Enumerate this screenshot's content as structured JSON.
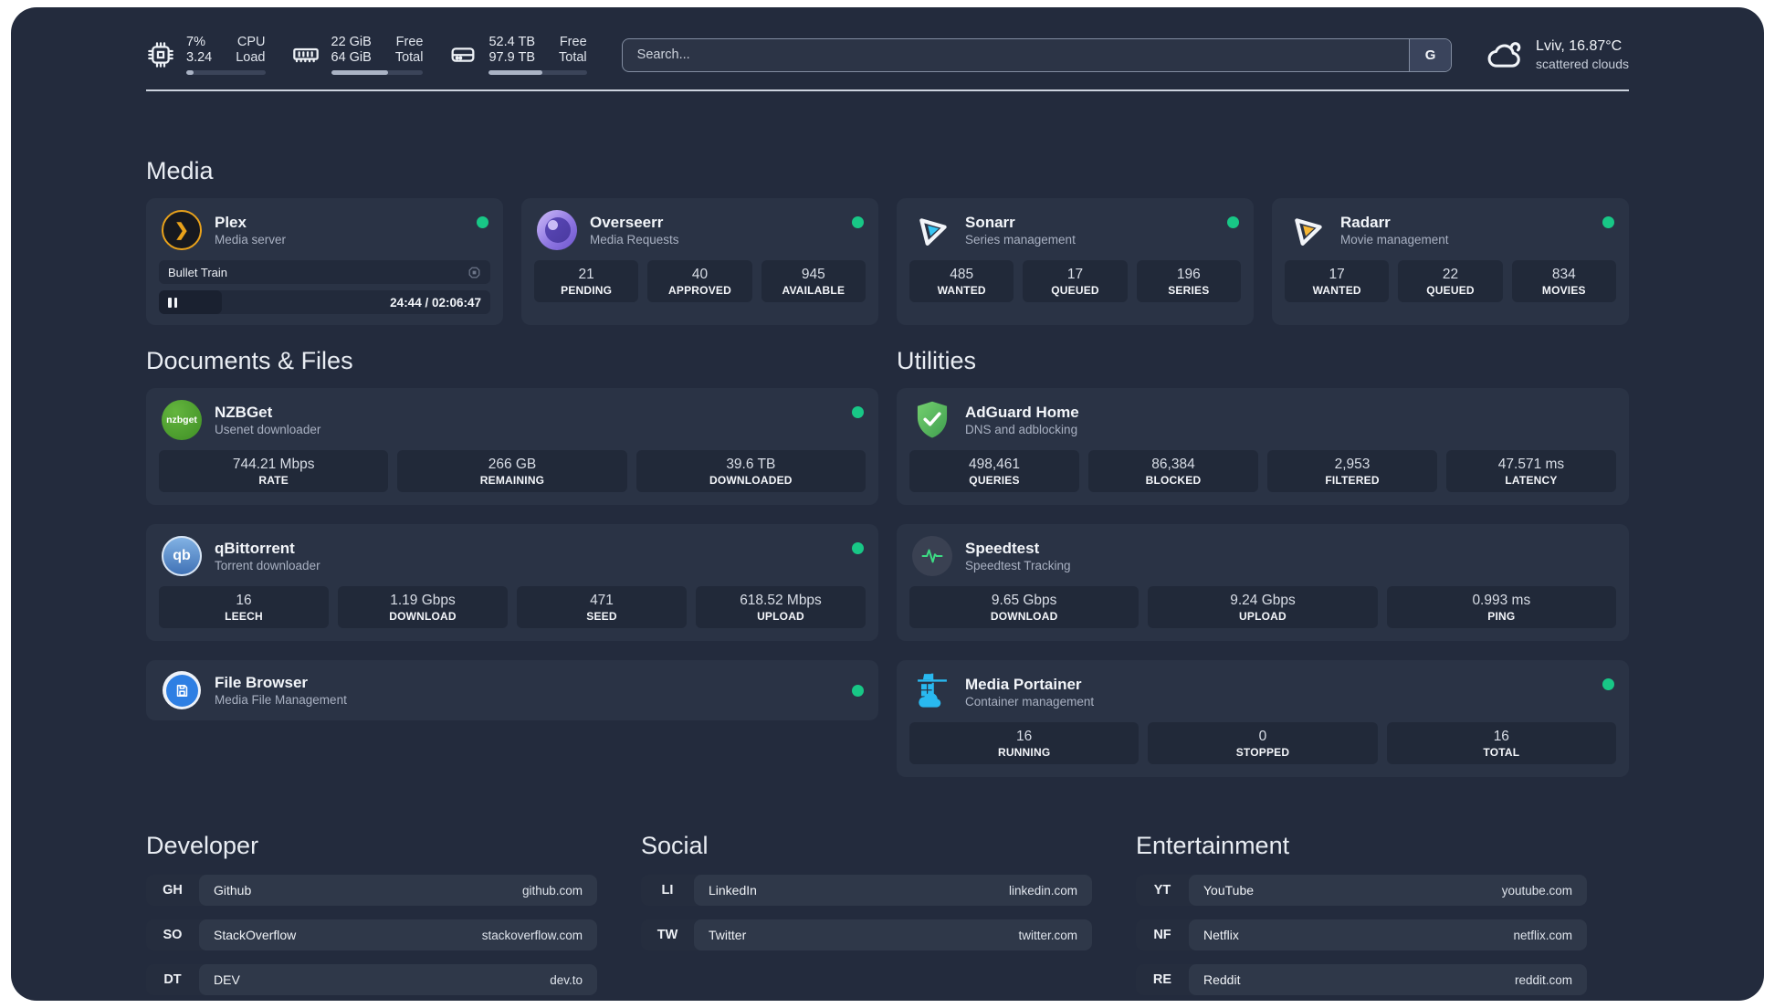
{
  "header": {
    "system": [
      {
        "icon": "cpu-icon",
        "value1": "7%",
        "label1": "CPU",
        "value2": "3.24",
        "label2": "Load",
        "progress": 9
      },
      {
        "icon": "ram-icon",
        "value1": "22 GiB",
        "label1": "Free",
        "value2": "64 GiB",
        "label2": "Total",
        "progress": 62
      },
      {
        "icon": "disk-icon",
        "value1": "52.4 TB",
        "label1": "Free",
        "value2": "97.9 TB",
        "label2": "Total",
        "progress": 55
      }
    ],
    "search": {
      "placeholder": "Search...",
      "button_label": "G"
    },
    "weather": {
      "icon": "cloud-icon",
      "location": "Lviv, 16.87°C",
      "condition": "scattered clouds"
    }
  },
  "media": {
    "title": "Media",
    "plex": {
      "icon": "plex-icon",
      "icon_glyph": "❯",
      "name": "Plex",
      "desc": "Media server",
      "now_playing": "Bullet Train",
      "time": "24:44 / 02:06:47",
      "progress": 19,
      "online": true
    },
    "overseerr": {
      "icon": "overseerr-icon",
      "name": "Overseerr",
      "desc": "Media Requests",
      "online": true,
      "stats": [
        {
          "value": "21",
          "label": "PENDING"
        },
        {
          "value": "40",
          "label": "APPROVED"
        },
        {
          "value": "945",
          "label": "AVAILABLE"
        }
      ]
    },
    "sonarr": {
      "icon": "sonarr-icon",
      "name": "Sonarr",
      "desc": "Series management",
      "online": true,
      "stats": [
        {
          "value": "485",
          "label": "WANTED"
        },
        {
          "value": "17",
          "label": "QUEUED"
        },
        {
          "value": "196",
          "label": "SERIES"
        }
      ]
    },
    "radarr": {
      "icon": "radarr-icon",
      "name": "Radarr",
      "desc": "Movie management",
      "online": true,
      "stats": [
        {
          "value": "17",
          "label": "WANTED"
        },
        {
          "value": "22",
          "label": "QUEUED"
        },
        {
          "value": "834",
          "label": "MOVIES"
        }
      ]
    }
  },
  "documents": {
    "title": "Documents & Files",
    "nzbget": {
      "icon": "nzbget-icon",
      "icon_text": "nzbget",
      "name": "NZBGet",
      "desc": "Usenet downloader",
      "online": true,
      "stats": [
        {
          "value": "744.21 Mbps",
          "label": "RATE"
        },
        {
          "value": "266 GB",
          "label": "REMAINING"
        },
        {
          "value": "39.6 TB",
          "label": "DOWNLOADED"
        }
      ]
    },
    "qbittorrent": {
      "icon": "qbittorrent-icon",
      "icon_text": "qb",
      "name": "qBittorrent",
      "desc": "Torrent downloader",
      "online": true,
      "stats": [
        {
          "value": "16",
          "label": "LEECH"
        },
        {
          "value": "1.19 Gbps",
          "label": "DOWNLOAD"
        },
        {
          "value": "471",
          "label": "SEED"
        },
        {
          "value": "618.52 Mbps",
          "label": "UPLOAD"
        }
      ]
    },
    "filebrowser": {
      "icon": "filebrowser-icon",
      "name": "File Browser",
      "desc": "Media File Management",
      "online": true
    }
  },
  "utilities": {
    "title": "Utilities",
    "adguard": {
      "icon": "adguard-icon",
      "name": "AdGuard Home",
      "desc": "DNS and adblocking",
      "stats": [
        {
          "value": "498,461",
          "label": "QUERIES"
        },
        {
          "value": "86,384",
          "label": "BLOCKED"
        },
        {
          "value": "2,953",
          "label": "FILTERED"
        },
        {
          "value": "47.571 ms",
          "label": "LATENCY"
        }
      ]
    },
    "speedtest": {
      "icon": "speedtest-icon",
      "name": "Speedtest",
      "desc": "Speedtest Tracking",
      "stats": [
        {
          "value": "9.65 Gbps",
          "label": "DOWNLOAD"
        },
        {
          "value": "9.24 Gbps",
          "label": "UPLOAD"
        },
        {
          "value": "0.993 ms",
          "label": "PING"
        }
      ]
    },
    "portainer": {
      "icon": "portainer-icon",
      "name": "Media Portainer",
      "desc": "Container management",
      "online": true,
      "stats": [
        {
          "value": "16",
          "label": "RUNNING"
        },
        {
          "value": "0",
          "label": "STOPPED"
        },
        {
          "value": "16",
          "label": "TOTAL"
        }
      ]
    }
  },
  "links": {
    "developer": {
      "title": "Developer",
      "items": [
        {
          "abbr": "GH",
          "name": "Github",
          "url": "github.com"
        },
        {
          "abbr": "SO",
          "name": "StackOverflow",
          "url": "stackoverflow.com"
        },
        {
          "abbr": "DT",
          "name": "DEV",
          "url": "dev.to"
        }
      ]
    },
    "social": {
      "title": "Social",
      "items": [
        {
          "abbr": "LI",
          "name": "LinkedIn",
          "url": "linkedin.com"
        },
        {
          "abbr": "TW",
          "name": "Twitter",
          "url": "twitter.com"
        }
      ]
    },
    "entertainment": {
      "title": "Entertainment",
      "items": [
        {
          "abbr": "YT",
          "name": "YouTube",
          "url": "youtube.com"
        },
        {
          "abbr": "NF",
          "name": "Netflix",
          "url": "netflix.com"
        },
        {
          "abbr": "RE",
          "name": "Reddit",
          "url": "reddit.com"
        }
      ]
    }
  },
  "colors": {
    "status_online": "#18c786",
    "plex_gold": "#e9a21b",
    "sonarr_cyan": "#35c5f3",
    "radarr_amber": "#f7b733",
    "nzbget_green": "#4f9d2f",
    "qbittorrent_blue": "#4a84c4",
    "filebrowser_blue": "#2e7fe3",
    "adguard_green": "#59b65c",
    "speedtest_green": "#3ddc84",
    "portainer_blue": "#29b9f0"
  }
}
